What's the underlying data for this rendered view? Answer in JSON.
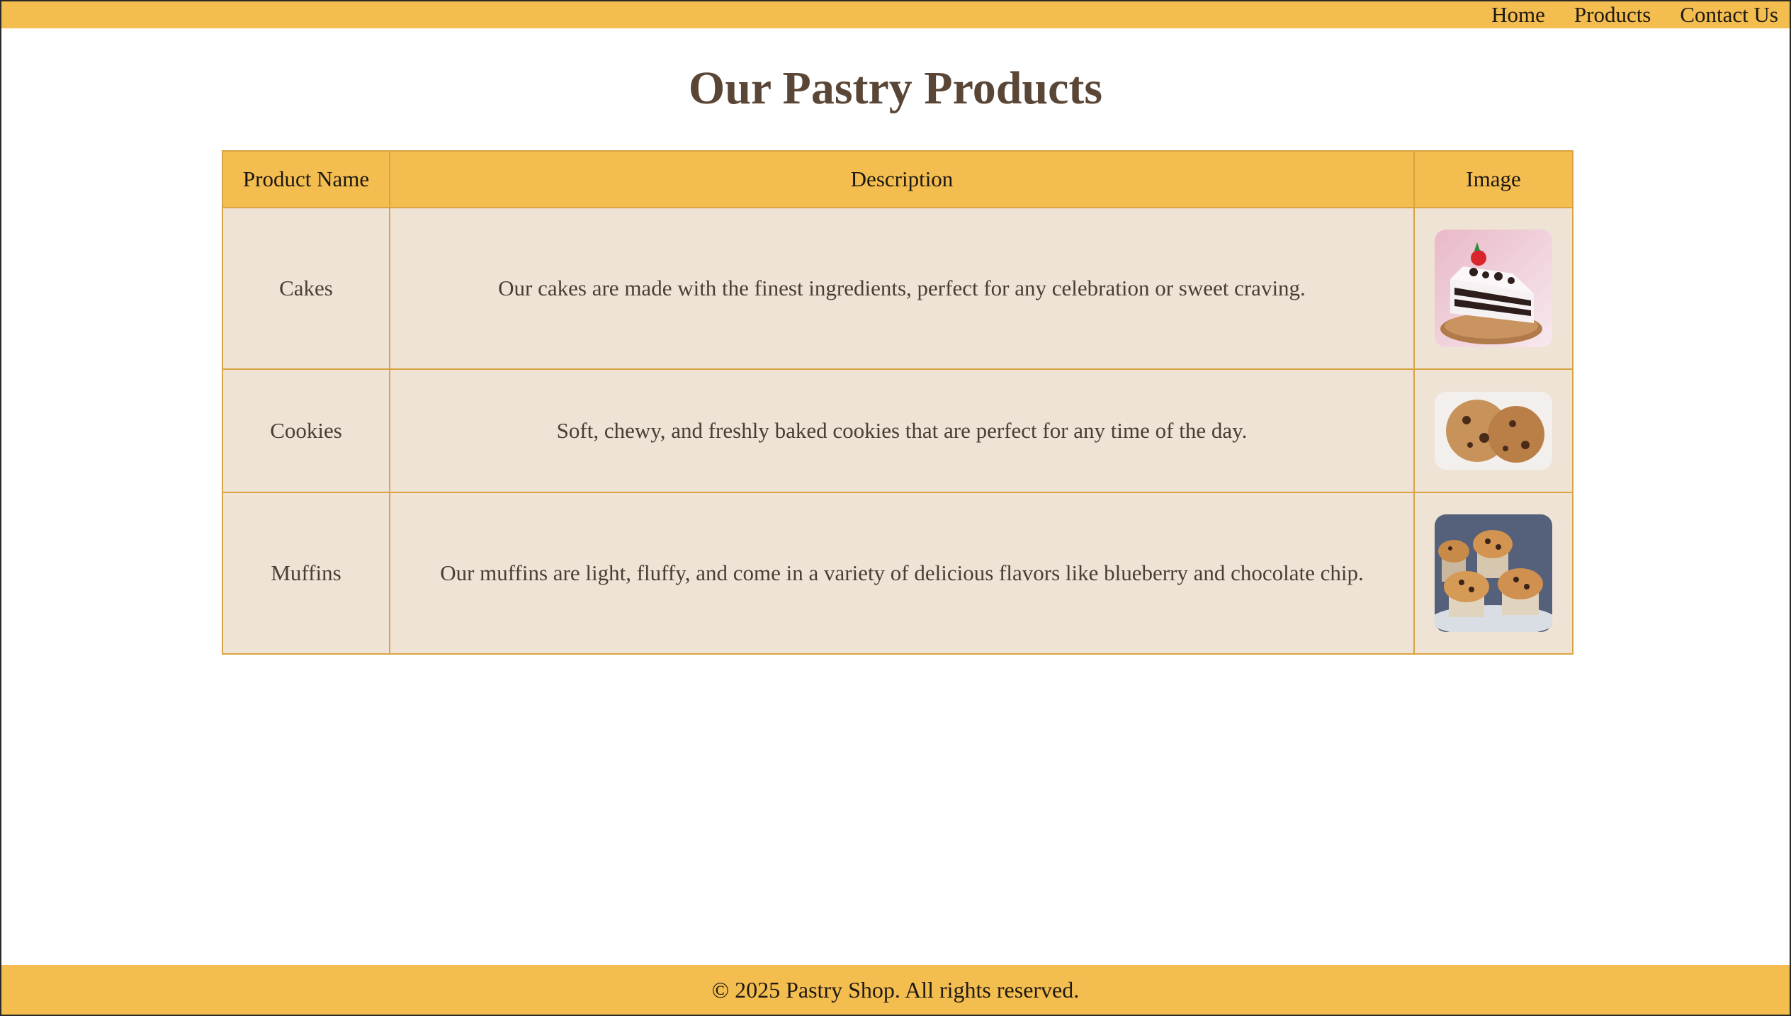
{
  "nav": {
    "items": [
      {
        "label": "Home"
      },
      {
        "label": "Products"
      },
      {
        "label": "Contact Us"
      }
    ]
  },
  "page": {
    "title": "Our Pastry Products"
  },
  "table": {
    "headers": [
      "Product Name",
      "Description",
      "Image"
    ],
    "rows": [
      {
        "name": "Cakes",
        "description": "Our cakes are made with the finest ingredients, perfect for any celebration or sweet craving.",
        "image": "cake-slice-photo"
      },
      {
        "name": "Cookies",
        "description": "Soft, chewy, and freshly baked cookies that are perfect for any time of the day.",
        "image": "cookies-photo"
      },
      {
        "name": "Muffins",
        "description": "Our muffins are light, fluffy, and come in a variety of delicious flavors like blueberry and chocolate chip.",
        "image": "muffins-photo"
      }
    ]
  },
  "footer": {
    "text": "© 2025 Pastry Shop. All rights reserved."
  },
  "colors": {
    "accent": "#f4bd4f",
    "row_bg": "#eee3d5",
    "title": "#5a4636",
    "border": "#d9a441"
  }
}
